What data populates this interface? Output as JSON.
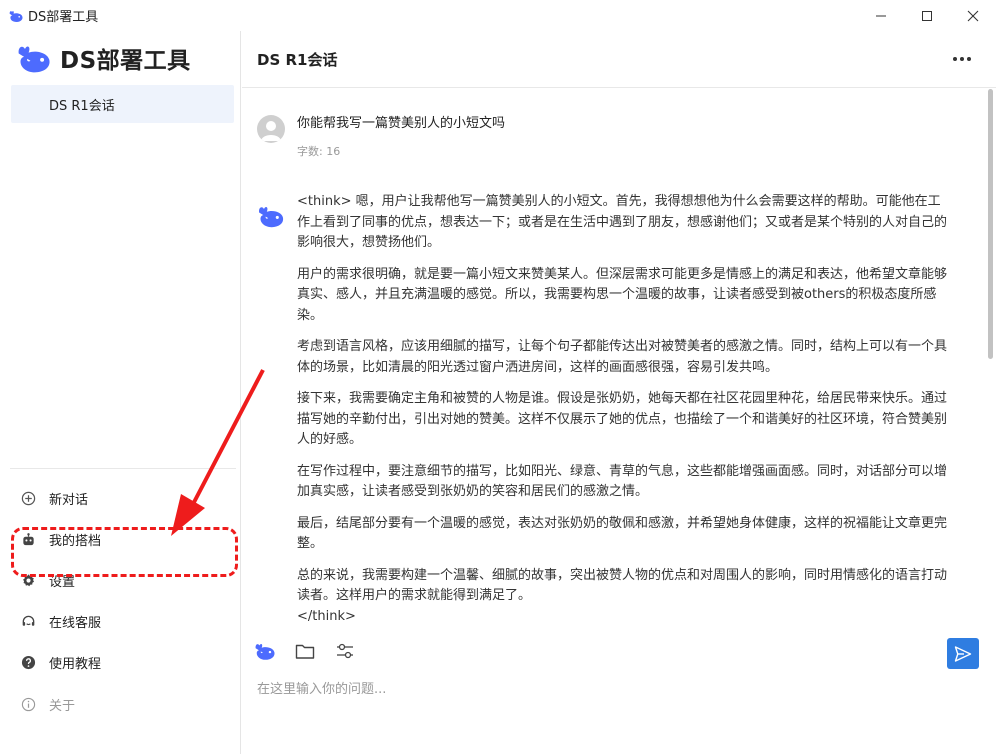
{
  "window": {
    "title": "DS部署工具",
    "app_icon": "whale-icon"
  },
  "sidebar": {
    "brand": "DS部署工具",
    "sessions": [
      {
        "label": "DS R1会话"
      }
    ],
    "menu": [
      {
        "label": "新对话",
        "icon": "plus-circle-icon"
      },
      {
        "label": "我的搭档",
        "icon": "robot-icon"
      },
      {
        "label": "设置",
        "icon": "gear-icon"
      },
      {
        "label": "在线客服",
        "icon": "headset-icon"
      },
      {
        "label": "使用教程",
        "icon": "help-circle-icon"
      },
      {
        "label": "关于",
        "icon": "info-icon"
      }
    ]
  },
  "header": {
    "title": "DS R1会话"
  },
  "chat": {
    "user_message": {
      "text": "你能帮我写一篇赞美别人的小短文吗",
      "meta": "字数: 16"
    },
    "bot_message": {
      "paragraphs": [
        "<think> 嗯，用户让我帮他写一篇赞美别人的小短文。首先，我得想想他为什么会需要这样的帮助。可能他在工作上看到了同事的优点，想表达一下；或者是在生活中遇到了朋友，想感谢他们；又或者是某个特别的人对自己的影响很大，想赞扬他们。",
        "用户的需求很明确，就是要一篇小短文来赞美某人。但深层需求可能更多是情感上的满足和表达，他希望文章能够真实、感人，并且充满温暖的感觉。所以，我需要构思一个温暖的故事，让读者感受到被others的积极态度所感染。",
        "考虑到语言风格，应该用细腻的描写，让每个句子都能传达出对被赞美者的感激之情。同时，结构上可以有一个具体的场景，比如清晨的阳光透过窗户洒进房间，这样的画面感很强，容易引发共鸣。",
        "接下来，我需要确定主角和被赞的人物是谁。假设是张奶奶，她每天都在社区花园里种花，给居民带来快乐。通过描写她的辛勤付出，引出对她的赞美。这样不仅展示了她的优点，也描绘了一个和谐美好的社区环境，符合赞美别人的好感。",
        "在写作过程中，要注意细节的描写，比如阳光、绿意、青草的气息，这些都能增强画面感。同时，对话部分可以增加真实感，让读者感受到张奶奶的笑容和居民们的感激之情。",
        "最后，结尾部分要有一个温暖的感觉，表达对张奶奶的敬佩和感激，并希望她身体健康，这样的祝福能让文章更完整。"
      ],
      "last_paragraph": "总的来说，我需要构建一个温馨、细腻的故事，突出被赞人物的优点和对周围人的影响，同时用情感化的语言打动读者。这样用户的需求就能得到满足了。",
      "think_end": "</think>"
    }
  },
  "input": {
    "placeholder": "在这里输入你的问题...",
    "tools": [
      "whale-icon",
      "folder-icon",
      "sliders-icon"
    ],
    "send_icon": "send-icon"
  },
  "colors": {
    "accent": "#2f7de1",
    "session_bg": "#eef3fc",
    "annotation": "#ee1c1c"
  }
}
